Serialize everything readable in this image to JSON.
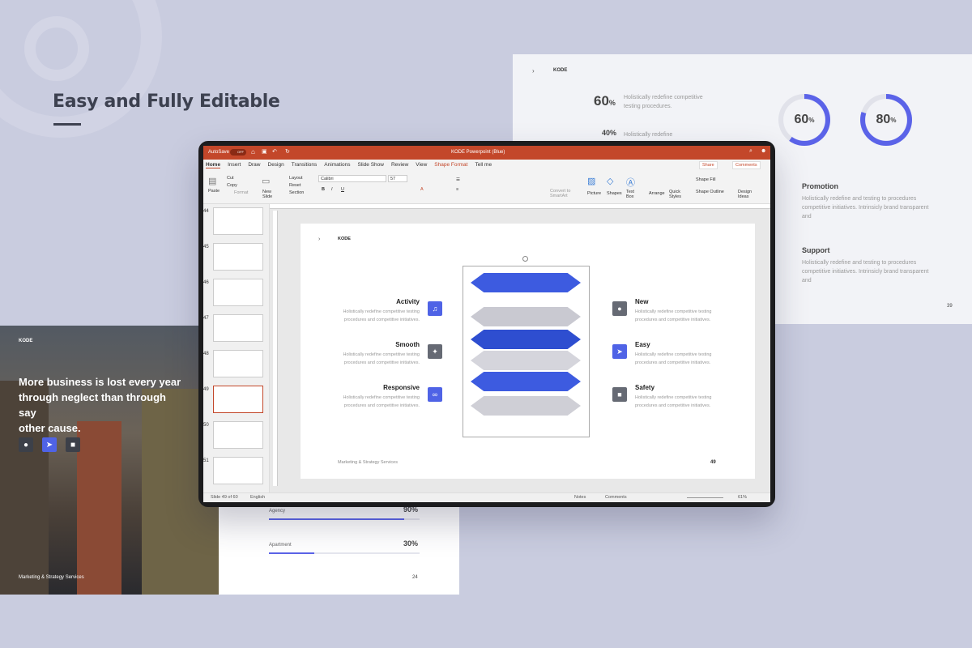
{
  "headline": "Easy and Fully Editable",
  "right_card": {
    "brand": "KODE",
    "stat1_value": "60",
    "stat1_unit": "%",
    "stat1_desc_l1": "Holistically redefine competitive",
    "stat1_desc_l2": "testing procedures.",
    "stat2_value": "40%",
    "stat2_desc": "Holistically redefine",
    "ring1_value": "60",
    "ring1_unit": "%",
    "ring1_fraction": 0.6,
    "ring2_value": "80",
    "ring2_unit": "%",
    "ring2_fraction": 0.8,
    "promotion_title": "Promotion",
    "promotion_l1": "Holistically redefine and testing to procedures",
    "promotion_l2": "competitive initiatives. Intrinsicly brand transparent",
    "promotion_l3": "and",
    "support_title": "Support",
    "support_l1": "Holistically redefine and testing to procedures",
    "support_l2": "competitive initiatives. Intrinsicly brand transparent",
    "support_l3": "and",
    "page": "39",
    "accent": "#5b63e8"
  },
  "left_card": {
    "brand": "KODE",
    "quote_l1": "More business is lost every year",
    "quote_l2": "through neglect than through say",
    "quote_l3": "other cause.",
    "footer": "Marketing & Strategy Services",
    "icons": [
      "bulb-icon",
      "cursor-icon",
      "lock-icon"
    ]
  },
  "bottom_card": {
    "bar1_label": "Agency",
    "bar1_value": "90%",
    "bar1_fraction": 0.9,
    "bar2_label": "Apartment",
    "bar2_value": "30%",
    "bar2_fraction": 0.3,
    "page": "24"
  },
  "app": {
    "autosave": "AutoSave",
    "autosave_state": "OFF",
    "title": "KODE Powerpoint (Blue)",
    "tabs": [
      "Home",
      "Insert",
      "Draw",
      "Design",
      "Transitions",
      "Animations",
      "Slide Show",
      "Review",
      "View",
      "Shape Format",
      "Tell me"
    ],
    "share": "Share",
    "comments": "Comments",
    "paste": "Paste",
    "cut": "Cut",
    "copy": "Copy",
    "format": "Format",
    "new_slide": "New Slide",
    "layout": "Layout",
    "reset": "Reset",
    "section": "Section",
    "font": "Calibri",
    "font_size": "57",
    "convert": "Convert to SmartArt",
    "picture": "Picture",
    "shapes": "Shapes",
    "text_box": "Text Box",
    "arrange": "Arrange",
    "quick_styles": "Quick Styles",
    "shape_fill": "Shape Fill",
    "shape_outline": "Shape Outline",
    "design_ideas": "Design Ideas",
    "status_slide": "Slide 49 of 60",
    "status_lang": "English",
    "notes": "Notes",
    "status_comments": "Comments",
    "zoom": "61%"
  },
  "thumbnails": [
    "44",
    "45",
    "46",
    "47",
    "48",
    "49",
    "50",
    "51"
  ],
  "slide": {
    "brand": "KODE",
    "footer": "Marketing & Strategy Services",
    "page": "49",
    "items_left": [
      {
        "title": "Activity",
        "l1": "Holistically redefine competitive testing",
        "l2": "procedures and competitive initiatives.",
        "icon": "music-icon"
      },
      {
        "title": "Smooth",
        "l1": "Holistically redefine competitive testing",
        "l2": "procedures and competitive initiatives.",
        "icon": "wand-icon"
      },
      {
        "title": "Responsive",
        "l1": "Holistically redefine competitive testing",
        "l2": "procedures and competitive initiatives.",
        "icon": "link-icon"
      }
    ],
    "items_right": [
      {
        "title": "New",
        "l1": "Holistically redefine competitive testing",
        "l2": "procedures and competitive initiatives.",
        "icon": "bulb-icon"
      },
      {
        "title": "Easy",
        "l1": "Holistically redefine competitive testing",
        "l2": "procedures and competitive initiatives.",
        "icon": "cursor-icon"
      },
      {
        "title": "Safety",
        "l1": "Holistically redefine competitive testing",
        "l2": "procedures and competitive initiatives.",
        "icon": "lock-icon"
      }
    ],
    "blue": "#3d5be0",
    "gray": "#c9c9d1"
  }
}
